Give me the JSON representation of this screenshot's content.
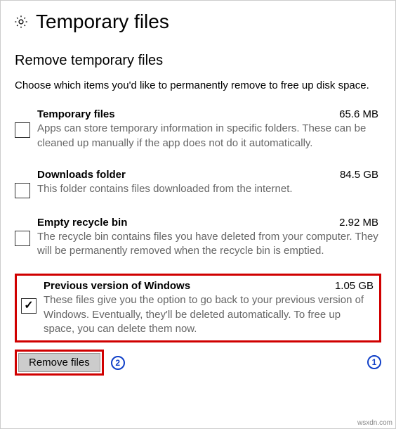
{
  "header": {
    "title": "Temporary files"
  },
  "section": {
    "title": "Remove temporary files",
    "intro": "Choose which items you'd like to permanently remove to free up disk space."
  },
  "items": [
    {
      "title": "Temporary files",
      "size": "65.6 MB",
      "desc": "Apps can store temporary information in specific folders. These can be cleaned up manually if the app does not do it automatically.",
      "checked": false
    },
    {
      "title": "Downloads folder",
      "size": "84.5 GB",
      "desc": "This folder contains files downloaded from the internet.",
      "checked": false
    },
    {
      "title": "Empty recycle bin",
      "size": "2.92 MB",
      "desc": "The recycle bin contains files you have deleted from your computer. They will be permanently removed when the recycle bin is emptied.",
      "checked": false
    },
    {
      "title": "Previous version of Windows",
      "size": "1.05 GB",
      "desc": "These files give you the option to go back to your previous version of Windows. Eventually, they'll be deleted automatically. To free up space, you can delete them now.",
      "checked": true
    }
  ],
  "actions": {
    "remove_label": "Remove files"
  },
  "annotations": {
    "one": "1",
    "two": "2"
  },
  "watermark": "wsxdn.com"
}
